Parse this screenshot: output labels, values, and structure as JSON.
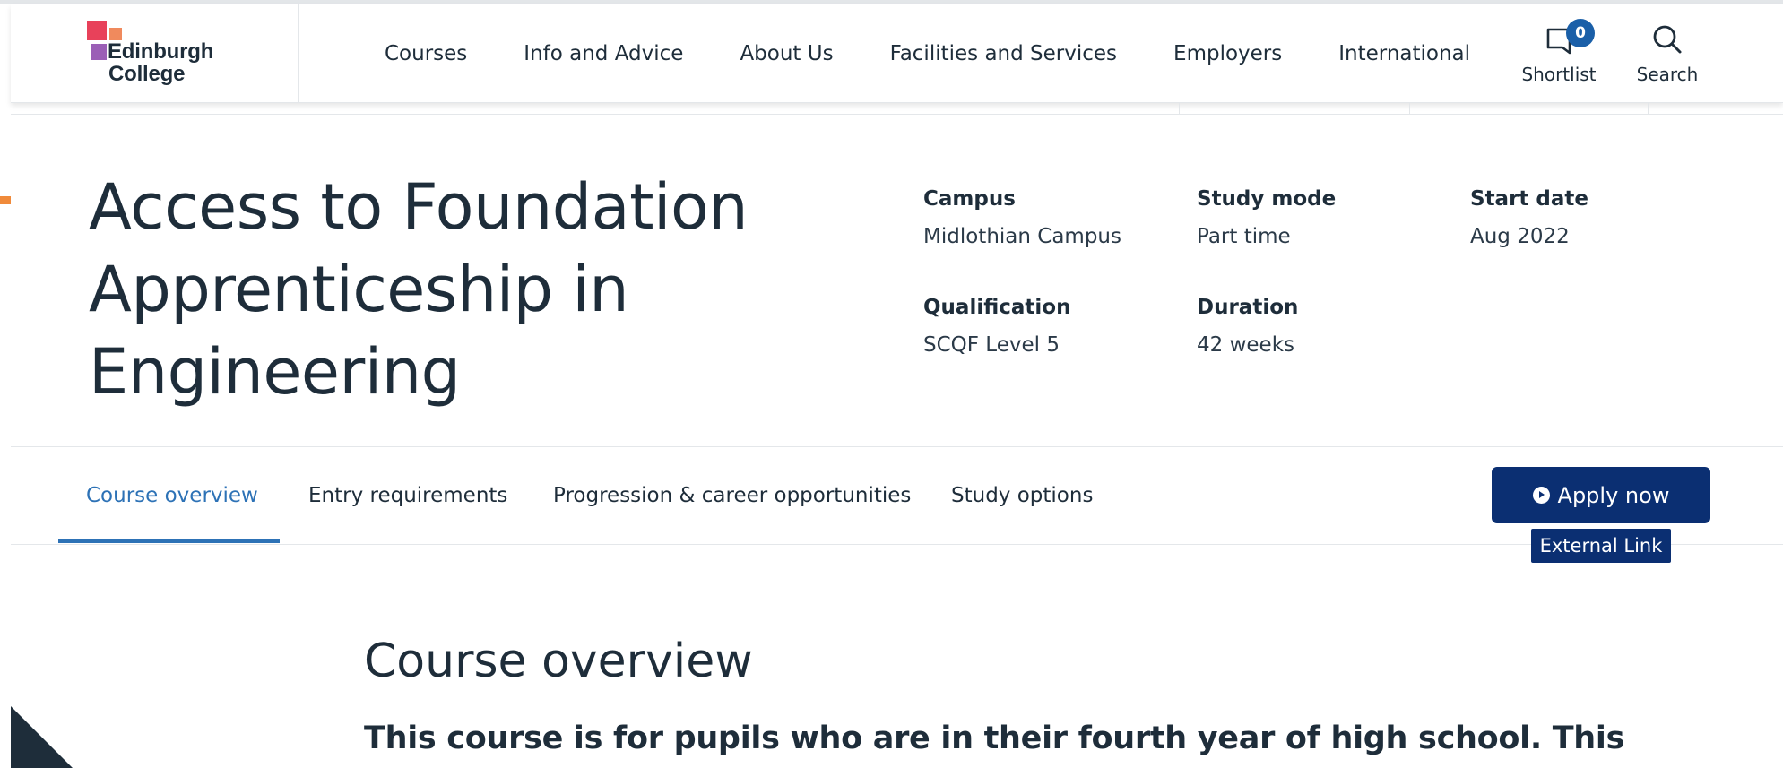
{
  "header": {
    "logo_line1": "Edinburgh",
    "logo_line2": "College",
    "nav": [
      "Courses",
      "Info and Advice",
      "About Us",
      "Facilities and Services",
      "Employers",
      "International"
    ],
    "shortlist_label": "Shortlist",
    "shortlist_count": "0",
    "search_label": "Search"
  },
  "course": {
    "title": "Access to Foundation Apprenticeship in Engineering",
    "campus_label": "Campus",
    "campus_value": "Midlothian Campus",
    "study_mode_label": "Study mode",
    "study_mode_value": "Part time",
    "start_date_label": "Start date",
    "start_date_value": "Aug 2022",
    "qualification_label": "Qualification",
    "qualification_value": "SCQF Level 5",
    "duration_label": "Duration",
    "duration_value": "42 weeks"
  },
  "tabs": [
    "Course overview",
    "Entry requirements",
    "Progression & career opportunities",
    "Study options"
  ],
  "active_tab": "Course overview",
  "apply": {
    "label": "Apply now",
    "tooltip": "External Link"
  },
  "overview": {
    "heading": "Course overview",
    "lead": "This course is for pupils who are in their fourth year of high school. This"
  },
  "colors": {
    "brand_navy": "#0b2f72",
    "link_blue": "#2d72b6",
    "text_dark": "#1e2d3a",
    "badge_blue": "#1a5fa8",
    "accent_orange": "#f08a3a"
  },
  "icons": {
    "shortlist": "bookmark-icon",
    "search": "search-icon",
    "apply": "circle-chevron-right-icon"
  }
}
